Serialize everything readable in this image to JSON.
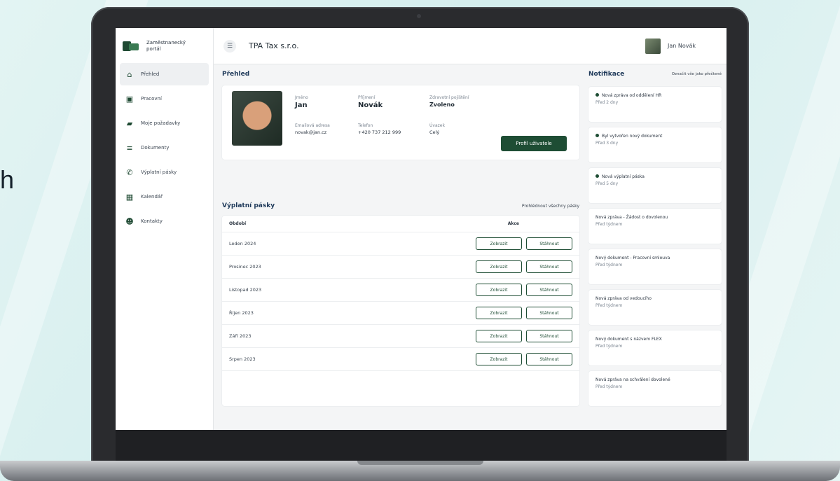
{
  "background": {
    "letter": "h"
  },
  "app": {
    "logo_text": "Zaměstnanecký portál",
    "company": "TPA Tax s.r.o.",
    "user_name": "Jan Novák"
  },
  "sidebar": {
    "items": [
      {
        "label": "Přehled",
        "icon": "home-icon",
        "active": true
      },
      {
        "label": "Pracovní",
        "icon": "briefcase-icon",
        "active": false
      },
      {
        "label": "Moje požadavky",
        "icon": "folder-icon",
        "active": false
      },
      {
        "label": "Dokumenty",
        "icon": "document-icon",
        "active": false
      },
      {
        "label": "Výplatní pásky",
        "icon": "money-icon",
        "active": false
      },
      {
        "label": "Kalendář",
        "icon": "calendar-icon",
        "active": false
      },
      {
        "label": "Kontakty",
        "icon": "people-icon",
        "active": false
      }
    ]
  },
  "overview": {
    "title": "Přehled",
    "profile": {
      "first_name_label": "Jméno",
      "first_name": "Jan",
      "last_name_label": "Příjmení",
      "last_name": "Novák",
      "status_label": "Zdravotní pojištění",
      "status": "Zvoleno",
      "email_label": "Emailová adresa",
      "email": "novak@jan.cz",
      "phone_label": "Telefon",
      "phone": "+420 737 212 999",
      "type_label": "Úvazek",
      "type": "Celý",
      "button": "Profil uživatele"
    }
  },
  "payslips": {
    "title": "Výplatní pásky",
    "link": "Prohlédnout všechny pásky",
    "columns": [
      "Období",
      "Akce"
    ],
    "view_label": "Zobrazit",
    "download_label": "Stáhnout",
    "rows": [
      "Leden 2024",
      "Prosinec 2023",
      "Listopad 2023",
      "Říjen 2023",
      "Září 2023",
      "Srpen 2023"
    ]
  },
  "notifications": {
    "title": "Notifikace",
    "link": "Označit vše jako přečtené",
    "items": [
      {
        "text": "Nová zpráva od oddělení HR",
        "when": "Před 2 dny",
        "unread": true
      },
      {
        "text": "Byl vytvořen nový dokument",
        "when": "Před 3 dny",
        "unread": true
      },
      {
        "text": "Nová výplatní páska",
        "when": "Před 5 dny",
        "unread": true
      },
      {
        "text": "Nová zpráva - Žádost o dovolenou",
        "when": "Před týdnem",
        "unread": false
      },
      {
        "text": "Nový dokument - Pracovní smlouva",
        "when": "Před týdnem",
        "unread": false
      },
      {
        "text": "Nová zpráva od vedoucího",
        "when": "Před týdnem",
        "unread": false
      },
      {
        "text": "Nový dokument s názvem FLEX",
        "when": "Před týdnem",
        "unread": false
      },
      {
        "text": "Nová zpráva na schválení dovolené",
        "when": "Před týdnem",
        "unread": false
      }
    ]
  }
}
